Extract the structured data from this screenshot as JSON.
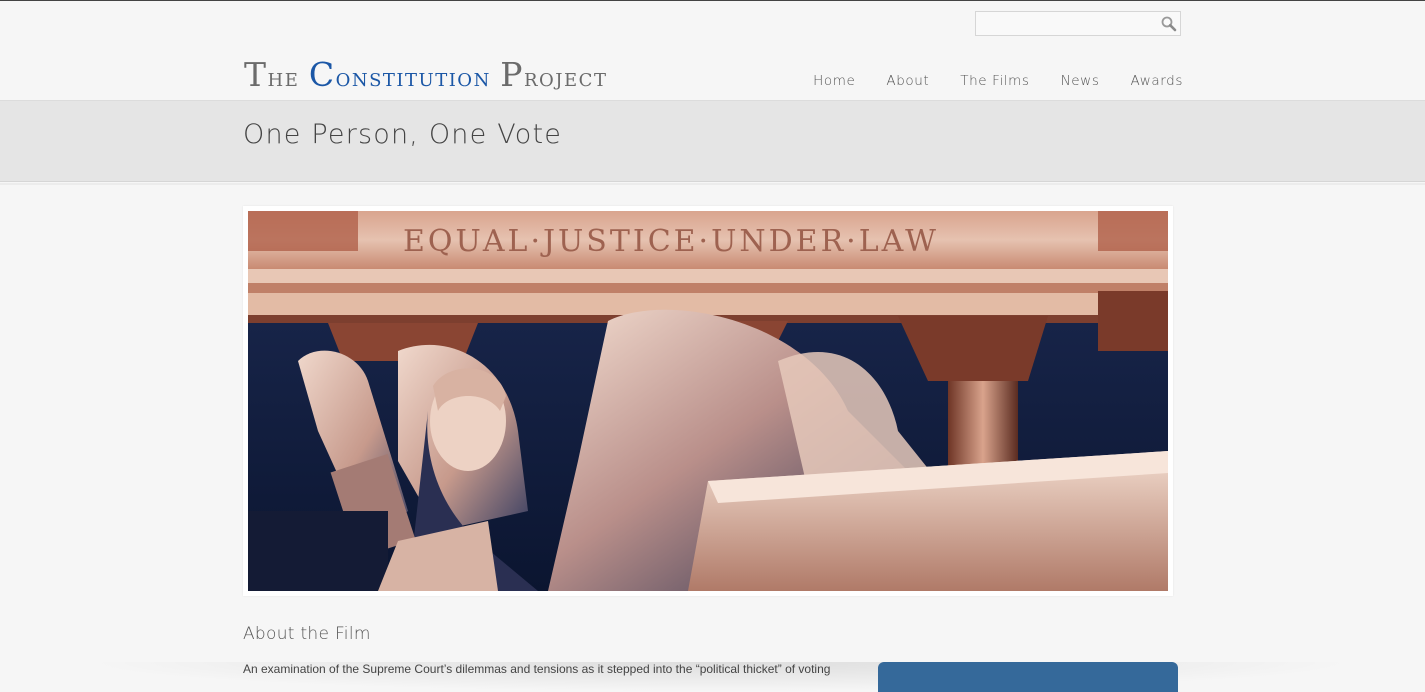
{
  "header": {
    "search_placeholder": "",
    "logo": {
      "the_first": "T",
      "the_rest": "he",
      "constitution_first": "C",
      "constitution_rest": "onstitution",
      "project_first": "P",
      "project_rest": "roject"
    },
    "nav": [
      "Home",
      "About",
      "The Films",
      "News",
      "Awards"
    ]
  },
  "page": {
    "title": "One Person, One Vote"
  },
  "hero": {
    "inscription": "EQUAL·JUSTICE·UNDER·LAW"
  },
  "content": {
    "section_heading": "About the Film",
    "intro": "An examination of the Supreme Court’s dilemmas and tensions as it stepped into the “political thicket” of voting"
  },
  "colors": {
    "accent_blue": "#1b57a6",
    "panel_blue": "#35699a",
    "background": "#f6f6f6",
    "band": "#e5e5e5"
  },
  "icons": {
    "search": "search-icon"
  }
}
